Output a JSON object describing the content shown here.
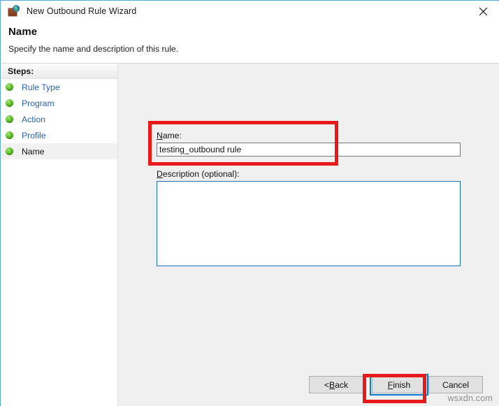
{
  "window": {
    "title": "New Outbound Rule Wizard",
    "icon": "firewall-globe-icon",
    "close_label": "✕",
    "frame_color": "#5aa9e0"
  },
  "header": {
    "title": "Name",
    "subtitle": "Specify the name and description of this rule."
  },
  "sidebar": {
    "header": "Steps:",
    "items": [
      {
        "label": "Rule Type",
        "current": false
      },
      {
        "label": "Program",
        "current": false
      },
      {
        "label": "Action",
        "current": false
      },
      {
        "label": "Profile",
        "current": false
      },
      {
        "label": "Name",
        "current": true
      }
    ],
    "link_color": "#2a63b0",
    "bullet_color": "#5fc02a"
  },
  "form": {
    "name": {
      "label_accel": "N",
      "label_rest": "ame:",
      "value": "testing_outbound rule",
      "placeholder": ""
    },
    "description": {
      "label_accel": "D",
      "label_rest": "escription (optional):",
      "value": "",
      "placeholder": ""
    }
  },
  "footer": {
    "back": {
      "prefix": "< ",
      "accel": "B",
      "rest": "ack"
    },
    "finish": {
      "accel": "F",
      "rest": "inish",
      "focused": true
    },
    "cancel": {
      "label": "Cancel"
    }
  },
  "annotations": {
    "color": "#e8191b",
    "boxes": [
      {
        "name": "name-field-highlight"
      },
      {
        "name": "finish-button-highlight"
      }
    ]
  },
  "watermark": "wsxdn.com"
}
